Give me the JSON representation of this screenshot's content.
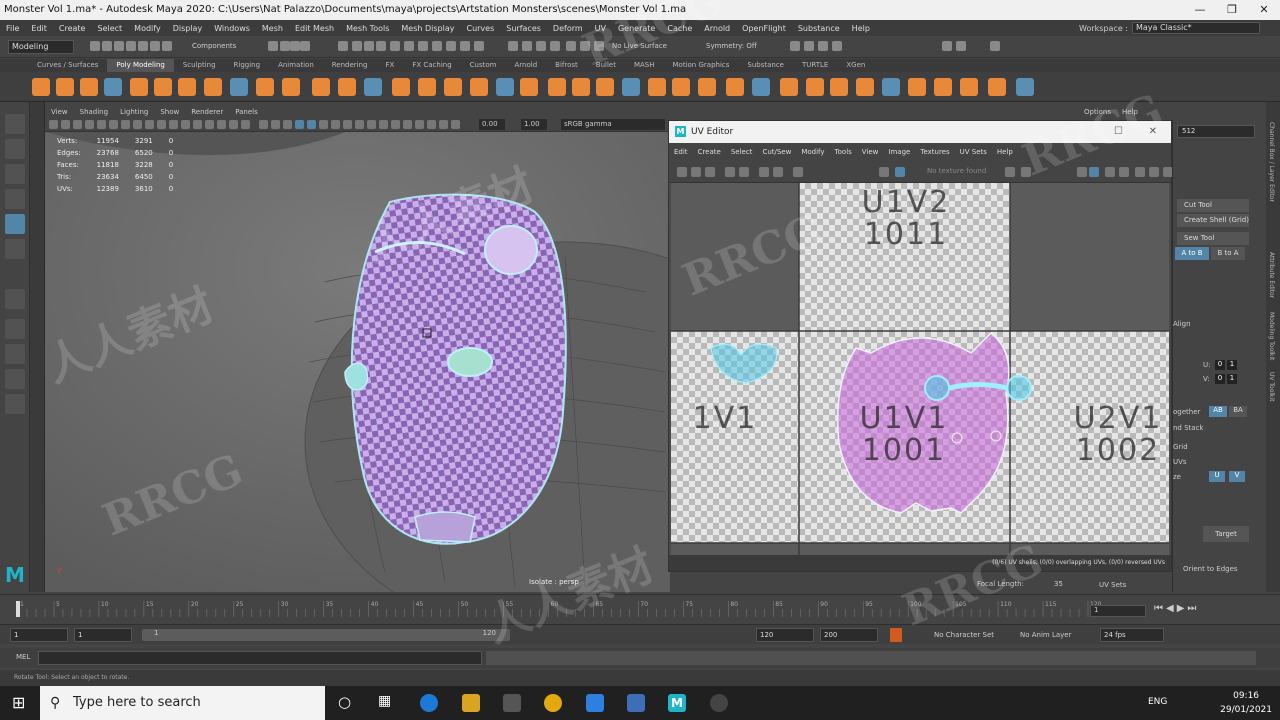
{
  "window": {
    "title": "Monster Vol 1.ma* - Autodesk Maya 2020: C:\\Users\\Nat Palazzo\\Documents\\maya\\projects\\Artstation Monsters\\scenes\\Monster Vol 1.ma"
  },
  "menubar": [
    "File",
    "Edit",
    "Create",
    "Select",
    "Modify",
    "Display",
    "Windows",
    "Mesh",
    "Edit Mesh",
    "Mesh Tools",
    "Mesh Display",
    "Curves",
    "Surfaces",
    "Deform",
    "UV",
    "Generate",
    "Cache",
    "Arnold",
    "OpenFlight",
    "Substance",
    "Help"
  ],
  "workspace": {
    "label": "Workspace :",
    "value": "Maya Classic*"
  },
  "statusline": {
    "mode": "Modeling",
    "components": "Components",
    "live_surface": "No Live Surface",
    "symmetry": "Symmetry: Off"
  },
  "shelf_tabs": [
    "Curves / Surfaces",
    "Poly Modeling",
    "Sculpting",
    "Rigging",
    "Animation",
    "Rendering",
    "FX",
    "FX Caching",
    "Custom",
    "Arnold",
    "Bifrost",
    "Bullet",
    "MASH",
    "Motion Graphics",
    "Substance",
    "TURTLE",
    "XGen"
  ],
  "shelf_active": "Poly Modeling",
  "viewport": {
    "menu": [
      "View",
      "Shading",
      "Lighting",
      "Show",
      "Renderer",
      "Panels"
    ],
    "exposure": "0.00",
    "gamma": "1.00",
    "color_space": "sRGB gamma",
    "hud": [
      {
        "label": "Verts:",
        "a": "11954",
        "b": "3291",
        "c": "0"
      },
      {
        "label": "Edges:",
        "a": "23768",
        "b": "6520",
        "c": "0"
      },
      {
        "label": "Faces:",
        "a": "11818",
        "b": "3228",
        "c": "0"
      },
      {
        "label": "Tris:",
        "a": "23634",
        "b": "6450",
        "c": "0"
      },
      {
        "label": "UVs:",
        "a": "12389",
        "b": "3610",
        "c": "0"
      }
    ],
    "isolate": "Isolate : persp",
    "focal_label": "Focal Length:",
    "focal_value": "35"
  },
  "uv_editor": {
    "title": "UV Editor",
    "menu": [
      "Edit",
      "Create",
      "Select",
      "Cut/Sew",
      "Modify",
      "Tools",
      "View",
      "Image",
      "Textures",
      "UV Sets",
      "Help"
    ],
    "texture": "No texture found",
    "tiles": {
      "u1v2": "U1V2\n1011",
      "u1v1": "U1V1\n1001",
      "u2v1": "U2V1\n1002",
      "left": "1V1"
    },
    "status": "(0/6) UV shells, (0/0) overlapping UVs, (0/0) reversed UVs"
  },
  "right_panel": {
    "header_options": "Options",
    "header_help": "Help",
    "res_field": "512",
    "cut_tool": "Cut Tool",
    "create_shell": "Create Shell (Grid)",
    "sew_tool": "Sew Tool",
    "a_to_b": "A to B",
    "b_to_a": "B to A",
    "align": "Align",
    "u_label": "U:",
    "v_label": "V:",
    "u_vals": [
      "0",
      "1"
    ],
    "v_vals": [
      "0",
      "1"
    ],
    "together": "ogether",
    "ab": "AB",
    "ba": "BA",
    "nd_stack": "nd Stack",
    "grid": "Grid",
    "uvs": "UVs",
    "ze": "ze",
    "u_btn": "U",
    "v_btn": "V",
    "target": "Target",
    "orient": "Orient to Edges",
    "uv_sets": "UV Sets"
  },
  "side_tabs": [
    "Channel Box / Layer Editor",
    "Attribute Editor",
    "Modeling Toolkit",
    "UV Toolkit"
  ],
  "timeslider": {
    "ticks": [
      "1",
      "5",
      "10",
      "15",
      "20",
      "25",
      "30",
      "35",
      "40",
      "45",
      "50",
      "55",
      "60",
      "65",
      "70",
      "75",
      "80",
      "85",
      "90",
      "95",
      "100",
      "105",
      "110",
      "115",
      "120"
    ],
    "current": "1"
  },
  "range": {
    "start": "1",
    "start2": "1",
    "bar_start": "1",
    "bar_end": "120",
    "end": "120",
    "end2": "200",
    "character_set": "No Character Set",
    "anim_layer": "No Anim Layer",
    "fps": "24 fps"
  },
  "mel": {
    "label": "MEL"
  },
  "helpline": "Rotate Tool: Select an object to rotate.",
  "taskbar": {
    "search": "Type here to search",
    "lang": "ENG",
    "time": "09:16",
    "date": "29/01/2021"
  },
  "colors": {
    "accent": "#5285a6",
    "maya_teal": "#1fb5c9",
    "shelf_orange": "#e8893a"
  },
  "watermark": [
    "RRCG",
    "人人素材"
  ]
}
